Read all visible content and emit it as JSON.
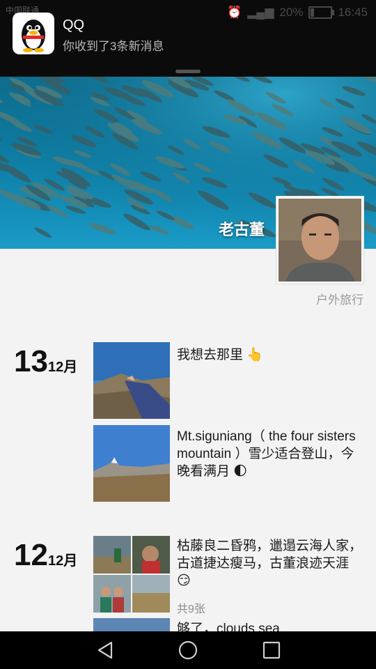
{
  "status_bar": {
    "carrier": "中国联通",
    "battery_text": "20%",
    "battery_level": 0.2,
    "time": "16:45"
  },
  "notification": {
    "app_name": "QQ",
    "message": "你收到了3条新消息",
    "app_icon": "qq-penguin-icon"
  },
  "profile": {
    "nickname": "老古董",
    "tag": "户外旅行"
  },
  "feed": [
    {
      "day": "13",
      "month": "12月",
      "posts": [
        {
          "text": "我想去那里",
          "emoji": "pointing-hand-icon"
        },
        {
          "text": "Mt.siguniang（ the four sisters mountain ）雪少适合登山，今晚看满月",
          "emoji": "moon-emoji-icon"
        }
      ]
    },
    {
      "day": "12",
      "month": "12月",
      "posts": [
        {
          "text": "枯藤良二昏鸦，邋遢云海人家，古道捷达瘦马，古董浪迹天涯",
          "emoji": "smirk-emoji-icon",
          "photo_count": "共9张"
        },
        {
          "text": "够了，clouds sea"
        }
      ]
    }
  ],
  "nav_bar": {
    "back": "back-triangle-icon",
    "home": "home-circle-icon",
    "recents": "recents-square-icon"
  },
  "colors": {
    "notification_bg": "#0b0b0b",
    "cover_sea": "#1289b3",
    "page_bg": "#f3f3f3"
  }
}
